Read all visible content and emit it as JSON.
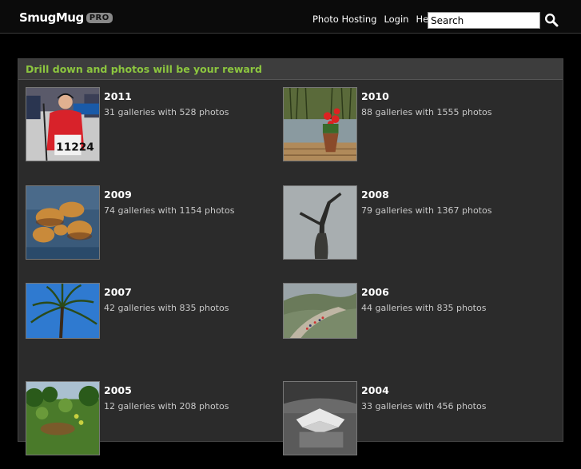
{
  "header": {
    "logo_text": "SmugMug",
    "logo_badge": "PRO",
    "nav": [
      "Photo Hosting",
      "Login",
      "Help"
    ],
    "search_placeholder": "Search"
  },
  "panel": {
    "title": "Drill down and photos will be your reward",
    "items": [
      {
        "year": "2011",
        "meta": "31 galleries with 528 photos"
      },
      {
        "year": "2010",
        "meta": "88 galleries with 1555 photos"
      },
      {
        "year": "2009",
        "meta": "74 galleries with 1154 photos"
      },
      {
        "year": "2008",
        "meta": "79 galleries with 1367 photos"
      },
      {
        "year": "2007",
        "meta": "42 galleries with 835 photos"
      },
      {
        "year": "2006",
        "meta": "44 galleries with 835 photos"
      },
      {
        "year": "2005",
        "meta": "12 galleries with 208 photos"
      },
      {
        "year": "2004",
        "meta": "33 galleries with 456 photos"
      }
    ]
  },
  "thumbnails": {
    "2011": "skier-race-photo",
    "2010": "flowers-on-dock-photo",
    "2009": "rocks-in-water-photo",
    "2008": "dead-tree-sky-photo",
    "2007": "palm-tree-photo",
    "2006": "great-wall-photo",
    "2005": "garden-photo",
    "2004": "tent-structure-photo"
  },
  "colors": {
    "accent": "#8cc63f",
    "background": "#000000",
    "panel": "#2b2b2b"
  }
}
